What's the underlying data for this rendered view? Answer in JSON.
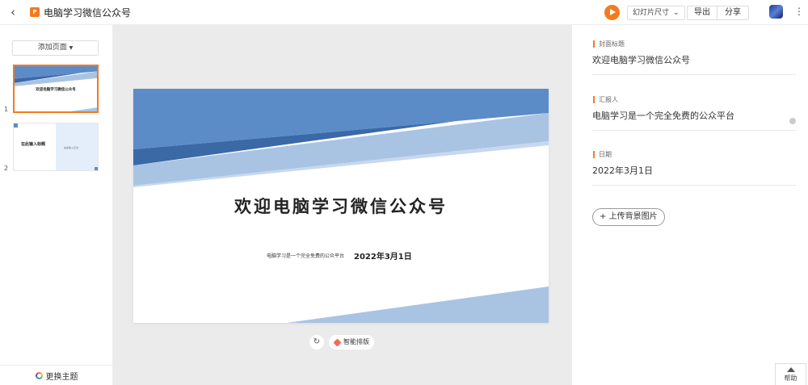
{
  "header": {
    "title": "电脑学习微信公众号",
    "doc_icon_text": "P",
    "slide_size_label": "幻灯片尺寸",
    "export_label": "导出",
    "share_label": "分享"
  },
  "left_panel": {
    "add_page_label": "添加页面",
    "thumbnails": [
      {
        "number": "1",
        "title": "欢迎电脑学习微信公众号"
      },
      {
        "number": "2",
        "title": "在此输入标题",
        "subtitle": "在此输入正文"
      }
    ],
    "theme_label": "更换主题"
  },
  "slide": {
    "title": "欢迎电脑学习微信公众号",
    "reporter": "电脑学习是一个完全免费的公众平台",
    "date": "2022年3月1日",
    "colors": {
      "primary": "#5b8cc8",
      "dark": "#3a69a6",
      "light": "#a9c3e3",
      "pale": "#c7d8ee"
    }
  },
  "canvas_tools": {
    "smart_layout_label": "智能排版"
  },
  "right_panel": {
    "fields": [
      {
        "label": "封面标题",
        "value": "欢迎电脑学习微信公众号"
      },
      {
        "label": "汇报人",
        "value": "电脑学习是一个完全免费的公众平台"
      },
      {
        "label": "日期",
        "value": "2022年3月1日"
      }
    ],
    "upload_label": "上传背景图片"
  },
  "help_label": "帮助",
  "accent_color": "#f47a20"
}
